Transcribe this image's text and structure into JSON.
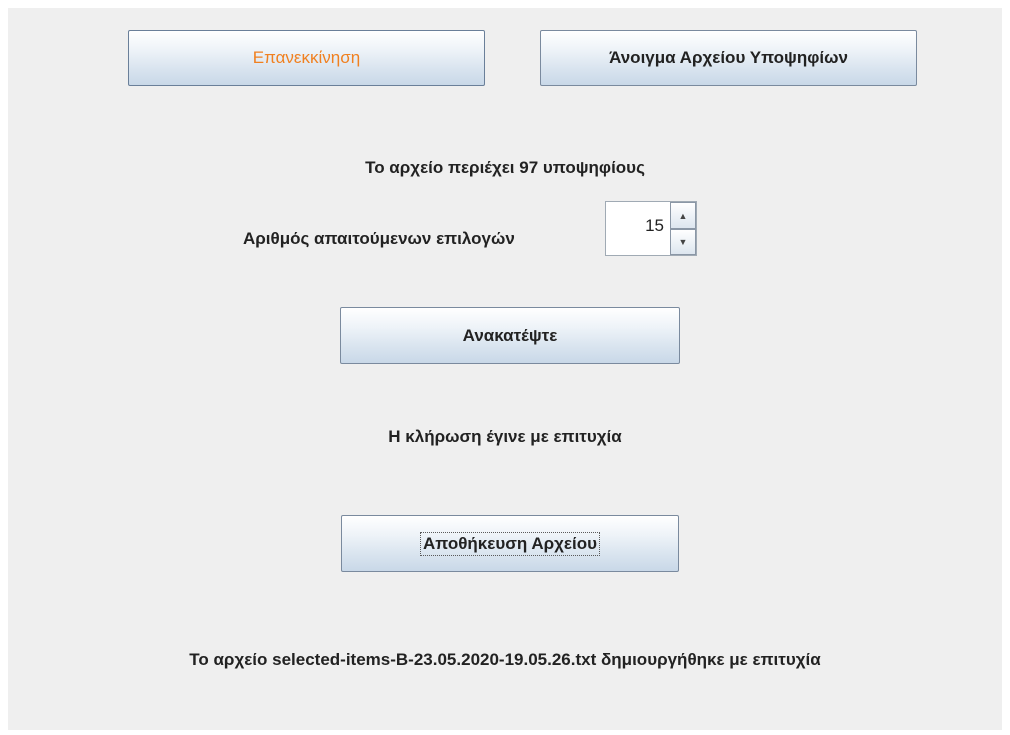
{
  "toolbar": {
    "restart_label": "Επανεκκίνηση",
    "open_candidates_label": "Άνοιγμα Αρχείου Υποψηφίων"
  },
  "info": {
    "file_contains": "Το αρχείο περιέχει 97 υποψηφίους"
  },
  "choices": {
    "label": "Αριθμός απαιτούμενων επιλογών",
    "value": "15",
    "up_arrow": "▲",
    "down_arrow": "▼"
  },
  "actions": {
    "shuffle_label": "Ανακατέψτε",
    "draw_status": "Η κλήρωση έγινε με επιτυχία",
    "save_label": "Αποθήκευση Αρχείου",
    "save_status": "Το αρχείο selected-items-B-23.05.2020-19.05.26.txt δημιουργήθηκε με επιτυχία"
  },
  "colors": {
    "focused_button_text": "#f08020",
    "window_background": "#efefef"
  }
}
